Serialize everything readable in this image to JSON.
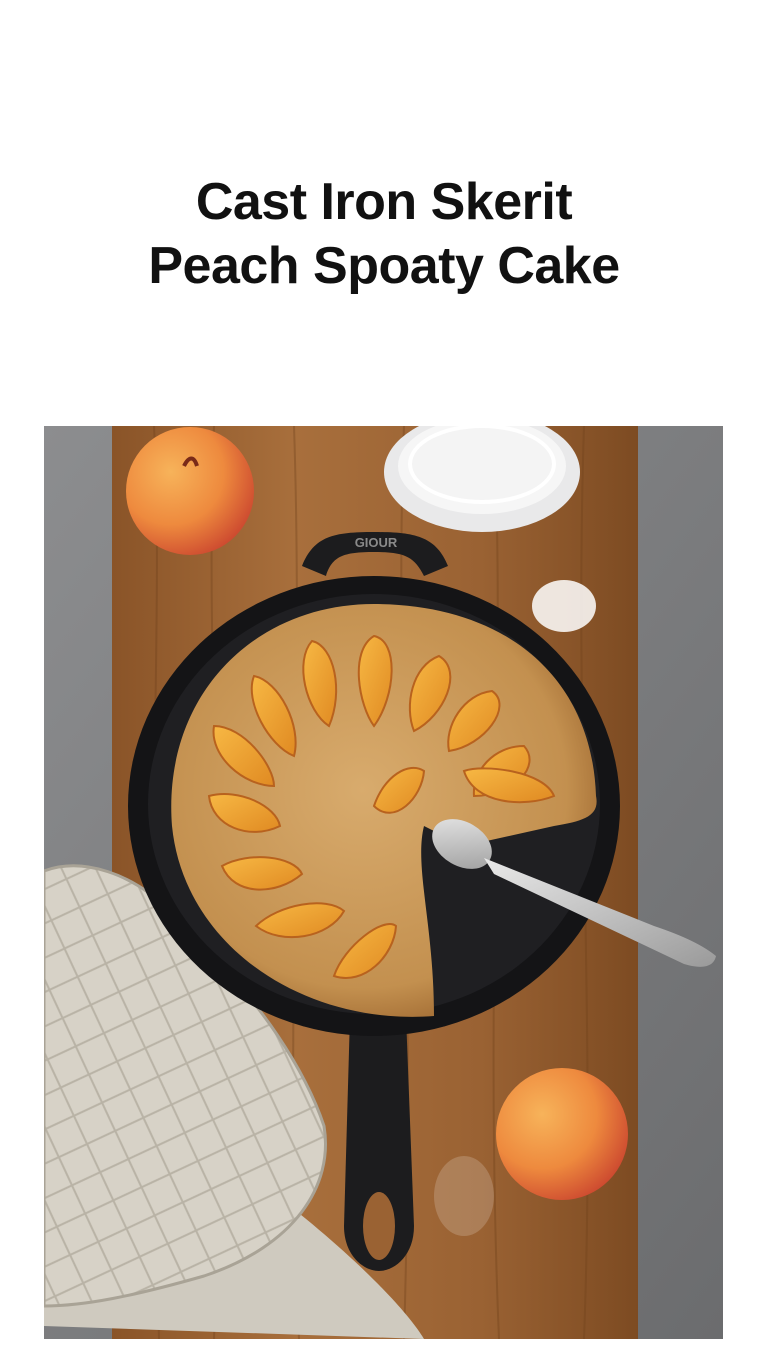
{
  "title": {
    "line1": "Cast Iron Skerit",
    "line2": "Peach Spoaty Cake"
  },
  "photo": {
    "description_alt": "Cast Iron Skerit Peach Spoaty Cake",
    "skillet_handle_text": "GIOUR",
    "colors": {
      "background": "#ffffff",
      "title": "#111111",
      "wood": "#9a6233",
      "cast_iron": "#1c1c1e",
      "cake": "#c99a5e",
      "peach": "#f0a23a",
      "linen": "#d9d5cc",
      "concrete": "#7d7e80"
    }
  }
}
